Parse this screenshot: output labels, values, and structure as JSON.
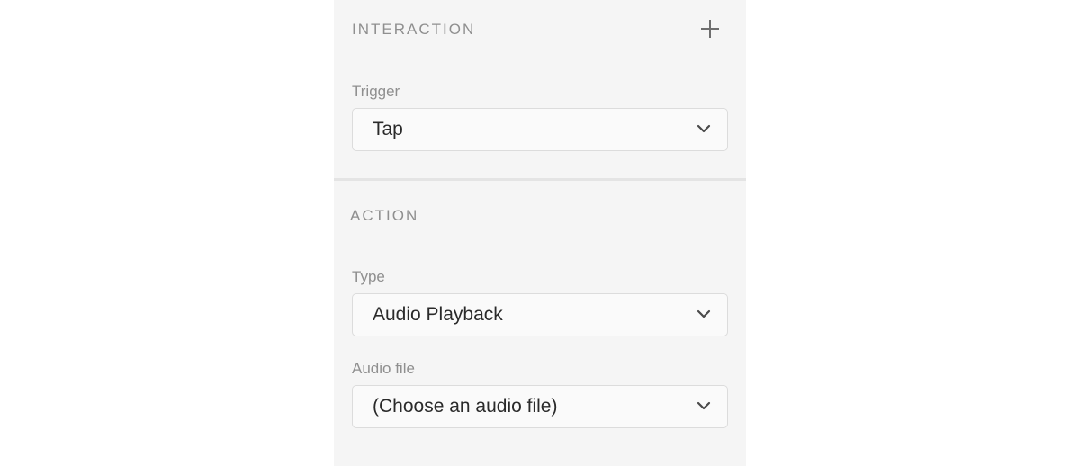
{
  "interaction": {
    "heading": "INTERACTION",
    "trigger": {
      "label": "Trigger",
      "value": "Tap"
    }
  },
  "action": {
    "heading": "ACTION",
    "type": {
      "label": "Type",
      "value": "Audio Playback"
    },
    "audio_file": {
      "label": "Audio file",
      "value": "(Choose an audio file)"
    }
  },
  "icons": {
    "add": "plus-icon",
    "dropdown": "chevron-down-icon"
  },
  "colors": {
    "panel_bg": "#f5f5f5",
    "heading_text": "#8f8f8f",
    "value_text": "#2a2a2a",
    "field_border": "#dcdcdc"
  }
}
